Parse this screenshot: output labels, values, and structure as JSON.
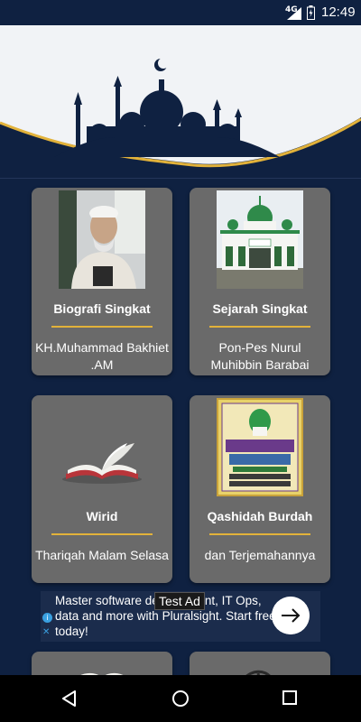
{
  "status_bar": {
    "network": "4G",
    "time": "12:49"
  },
  "colors": {
    "background": "#0f2141",
    "card": "#6a6a6a",
    "accent_gold": "#e2b23a"
  },
  "cards": [
    {
      "title": "Biografi Singkat",
      "subtitle": "KH.Muhammad Bakhiet .AM",
      "icon": "portrait-photo"
    },
    {
      "title": "Sejarah Singkat",
      "subtitle": "Pon-Pes Nurul Muhibbin Barabai",
      "icon": "mosque-photo"
    },
    {
      "title": "Wirid",
      "subtitle": "Thariqah Malam Selasa",
      "icon": "open-book-icon"
    },
    {
      "title": "Qashidah Burdah",
      "subtitle": "dan Terjemahannya",
      "icon": "burdah-cover"
    }
  ],
  "ad": {
    "text": "Master software development, IT Ops, data and more with Pluralsight. Start free today!",
    "badge": "Test Ad"
  },
  "nav_bar": {
    "back": "back-icon",
    "home": "home-icon",
    "recents": "recents-icon"
  }
}
